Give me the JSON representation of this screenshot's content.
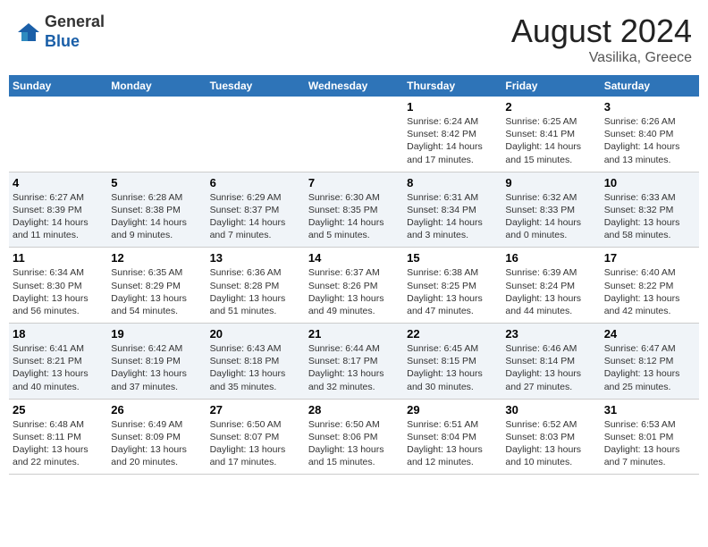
{
  "logo": {
    "general": "General",
    "blue": "Blue"
  },
  "title": "August 2024",
  "subtitle": "Vasilika, Greece",
  "days_of_week": [
    "Sunday",
    "Monday",
    "Tuesday",
    "Wednesday",
    "Thursday",
    "Friday",
    "Saturday"
  ],
  "weeks": [
    [
      {
        "day": "",
        "info": ""
      },
      {
        "day": "",
        "info": ""
      },
      {
        "day": "",
        "info": ""
      },
      {
        "day": "",
        "info": ""
      },
      {
        "day": "1",
        "info": "Sunrise: 6:24 AM\nSunset: 8:42 PM\nDaylight: 14 hours\nand 17 minutes."
      },
      {
        "day": "2",
        "info": "Sunrise: 6:25 AM\nSunset: 8:41 PM\nDaylight: 14 hours\nand 15 minutes."
      },
      {
        "day": "3",
        "info": "Sunrise: 6:26 AM\nSunset: 8:40 PM\nDaylight: 14 hours\nand 13 minutes."
      }
    ],
    [
      {
        "day": "4",
        "info": "Sunrise: 6:27 AM\nSunset: 8:39 PM\nDaylight: 14 hours\nand 11 minutes."
      },
      {
        "day": "5",
        "info": "Sunrise: 6:28 AM\nSunset: 8:38 PM\nDaylight: 14 hours\nand 9 minutes."
      },
      {
        "day": "6",
        "info": "Sunrise: 6:29 AM\nSunset: 8:37 PM\nDaylight: 14 hours\nand 7 minutes."
      },
      {
        "day": "7",
        "info": "Sunrise: 6:30 AM\nSunset: 8:35 PM\nDaylight: 14 hours\nand 5 minutes."
      },
      {
        "day": "8",
        "info": "Sunrise: 6:31 AM\nSunset: 8:34 PM\nDaylight: 14 hours\nand 3 minutes."
      },
      {
        "day": "9",
        "info": "Sunrise: 6:32 AM\nSunset: 8:33 PM\nDaylight: 14 hours\nand 0 minutes."
      },
      {
        "day": "10",
        "info": "Sunrise: 6:33 AM\nSunset: 8:32 PM\nDaylight: 13 hours\nand 58 minutes."
      }
    ],
    [
      {
        "day": "11",
        "info": "Sunrise: 6:34 AM\nSunset: 8:30 PM\nDaylight: 13 hours\nand 56 minutes."
      },
      {
        "day": "12",
        "info": "Sunrise: 6:35 AM\nSunset: 8:29 PM\nDaylight: 13 hours\nand 54 minutes."
      },
      {
        "day": "13",
        "info": "Sunrise: 6:36 AM\nSunset: 8:28 PM\nDaylight: 13 hours\nand 51 minutes."
      },
      {
        "day": "14",
        "info": "Sunrise: 6:37 AM\nSunset: 8:26 PM\nDaylight: 13 hours\nand 49 minutes."
      },
      {
        "day": "15",
        "info": "Sunrise: 6:38 AM\nSunset: 8:25 PM\nDaylight: 13 hours\nand 47 minutes."
      },
      {
        "day": "16",
        "info": "Sunrise: 6:39 AM\nSunset: 8:24 PM\nDaylight: 13 hours\nand 44 minutes."
      },
      {
        "day": "17",
        "info": "Sunrise: 6:40 AM\nSunset: 8:22 PM\nDaylight: 13 hours\nand 42 minutes."
      }
    ],
    [
      {
        "day": "18",
        "info": "Sunrise: 6:41 AM\nSunset: 8:21 PM\nDaylight: 13 hours\nand 40 minutes."
      },
      {
        "day": "19",
        "info": "Sunrise: 6:42 AM\nSunset: 8:19 PM\nDaylight: 13 hours\nand 37 minutes."
      },
      {
        "day": "20",
        "info": "Sunrise: 6:43 AM\nSunset: 8:18 PM\nDaylight: 13 hours\nand 35 minutes."
      },
      {
        "day": "21",
        "info": "Sunrise: 6:44 AM\nSunset: 8:17 PM\nDaylight: 13 hours\nand 32 minutes."
      },
      {
        "day": "22",
        "info": "Sunrise: 6:45 AM\nSunset: 8:15 PM\nDaylight: 13 hours\nand 30 minutes."
      },
      {
        "day": "23",
        "info": "Sunrise: 6:46 AM\nSunset: 8:14 PM\nDaylight: 13 hours\nand 27 minutes."
      },
      {
        "day": "24",
        "info": "Sunrise: 6:47 AM\nSunset: 8:12 PM\nDaylight: 13 hours\nand 25 minutes."
      }
    ],
    [
      {
        "day": "25",
        "info": "Sunrise: 6:48 AM\nSunset: 8:11 PM\nDaylight: 13 hours\nand 22 minutes."
      },
      {
        "day": "26",
        "info": "Sunrise: 6:49 AM\nSunset: 8:09 PM\nDaylight: 13 hours\nand 20 minutes."
      },
      {
        "day": "27",
        "info": "Sunrise: 6:50 AM\nSunset: 8:07 PM\nDaylight: 13 hours\nand 17 minutes."
      },
      {
        "day": "28",
        "info": "Sunrise: 6:50 AM\nSunset: 8:06 PM\nDaylight: 13 hours\nand 15 minutes."
      },
      {
        "day": "29",
        "info": "Sunrise: 6:51 AM\nSunset: 8:04 PM\nDaylight: 13 hours\nand 12 minutes."
      },
      {
        "day": "30",
        "info": "Sunrise: 6:52 AM\nSunset: 8:03 PM\nDaylight: 13 hours\nand 10 minutes."
      },
      {
        "day": "31",
        "info": "Sunrise: 6:53 AM\nSunset: 8:01 PM\nDaylight: 13 hours\nand 7 minutes."
      }
    ]
  ]
}
